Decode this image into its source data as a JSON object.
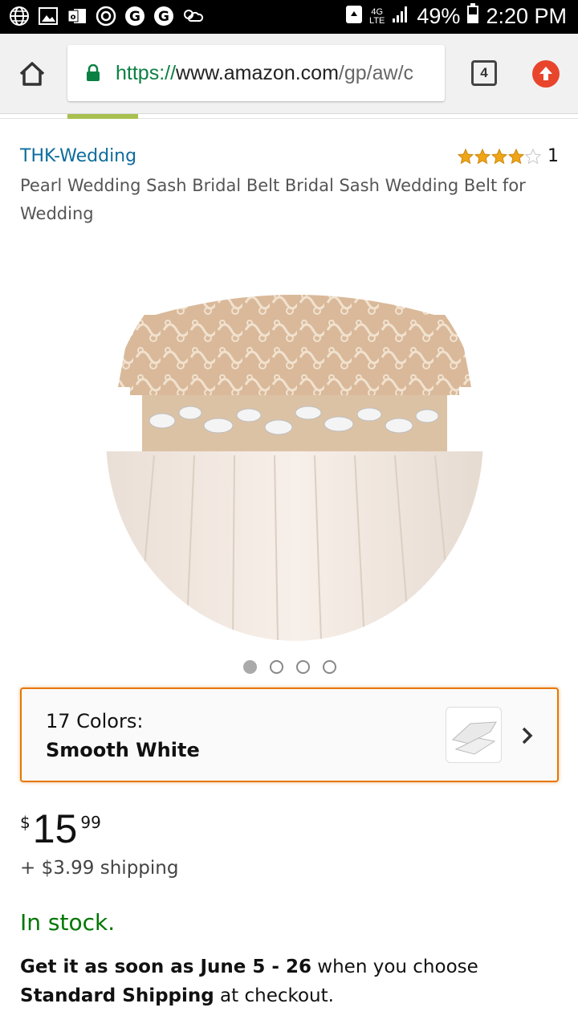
{
  "status_bar": {
    "battery": "49%",
    "time": "2:20 PM",
    "network": "4G\nLTE"
  },
  "browser": {
    "url_scheme": "https://",
    "url_host": "www.amazon.com",
    "url_path": "/gp/aw/c",
    "tab_count": "4"
  },
  "product": {
    "brand": "THK-Wedding",
    "rating_stars": 4,
    "rating_count": "1",
    "title": "Pearl Wedding Sash Bridal Belt Bridal Sash Wedding Belt for Wedding",
    "image_count": 4,
    "image_active_index": 0
  },
  "variation": {
    "label": "17 Colors:",
    "value": "Smooth White"
  },
  "price": {
    "symbol": "$",
    "whole": "15",
    "fraction": "99",
    "shipping": "+ $3.99 shipping"
  },
  "availability": "In stock.",
  "delivery": {
    "prefix": "Get it as soon as June 5 - 26",
    "middle": " when you choose ",
    "method": "Standard Shipping",
    "suffix": " at checkout."
  },
  "colors": {
    "brand_link": "#0e6c9c",
    "star": "#f0a417",
    "in_stock": "#007600",
    "variation_border": "#e77600"
  }
}
